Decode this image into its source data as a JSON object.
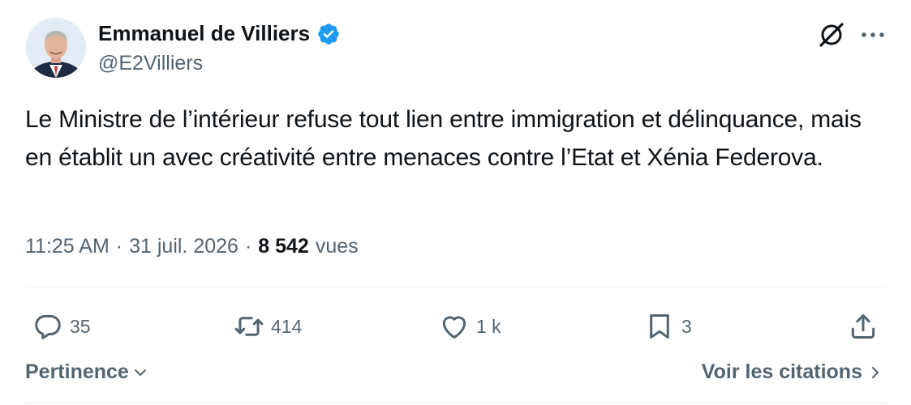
{
  "author": {
    "display_name": "Emmanuel de Villiers",
    "handle": "@E2Villiers",
    "verified": true,
    "verified_color": "#1d9bf0"
  },
  "tweet": {
    "text": "Le Ministre de l’intérieur refuse tout lien entre immigration et délinquance, mais en établit un avec créativité entre menaces contre l’Etat et Xénia Federova."
  },
  "meta": {
    "time": "11:25 AM",
    "separator": "·",
    "date": "31 juil. 2026",
    "views_count": "8 542",
    "views_label": "vues"
  },
  "actions": {
    "reply_count": "35",
    "retweet_count": "414",
    "like_count": "1 k",
    "bookmark_count": "3"
  },
  "footer": {
    "sort_label": "Pertinence",
    "quotes_label": "Voir les citations"
  },
  "icons": {
    "grok": "grok-icon",
    "more": "more-icon",
    "reply": "reply-icon",
    "retweet": "retweet-icon",
    "like": "heart-icon",
    "bookmark": "bookmark-icon",
    "share": "share-icon"
  }
}
